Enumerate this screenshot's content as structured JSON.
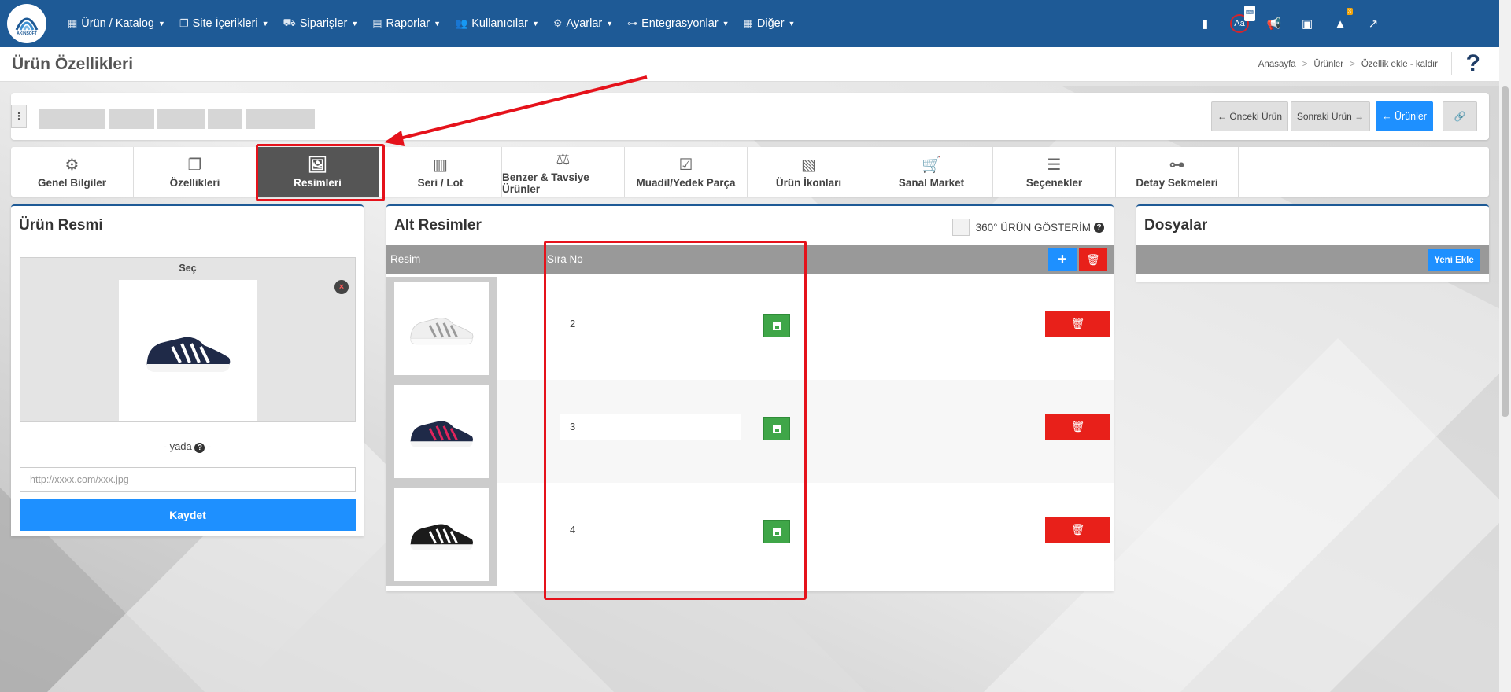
{
  "brand": {
    "logo_text": "AKINSOFT"
  },
  "nav": {
    "items": [
      {
        "label": "Ürün / Katalog",
        "icon": "cubes-icon"
      },
      {
        "label": "Site İçerikleri",
        "icon": "copy-icon"
      },
      {
        "label": "Siparişler",
        "icon": "truck-icon"
      },
      {
        "label": "Raporlar",
        "icon": "file-chart-icon"
      },
      {
        "label": "Kullanıcılar",
        "icon": "users-icon"
      },
      {
        "label": "Ayarlar",
        "icon": "gears-icon"
      },
      {
        "label": "Entegrasyonlar",
        "icon": "sitemap-icon"
      },
      {
        "label": "Diğer",
        "icon": "grid-icon"
      }
    ],
    "right_icons": [
      "book-icon",
      "translate-icon",
      "megaphone-icon",
      "windows-icon",
      "alert-icon",
      "external-edit-icon"
    ],
    "alert_count": "3",
    "keyboard_badge": "⌨"
  },
  "title_bar": {
    "title": "Ürün Özellikleri",
    "breadcrumb": [
      "Anasayfa",
      "Ürünler",
      "Özellik ekle - kaldır"
    ],
    "help": "?"
  },
  "product_header": {
    "prev_label": "Önceki Ürün",
    "next_label": "Sonraki Ürün",
    "products_label": "Ürünler"
  },
  "tabs": [
    {
      "label": "Genel Bilgiler",
      "icon": "gears-icon"
    },
    {
      "label": "Özellikleri",
      "icon": "copy-icon"
    },
    {
      "label": "Resimleri",
      "icon": "images-icon",
      "active": true
    },
    {
      "label": "Seri / Lot",
      "icon": "barcode-icon"
    },
    {
      "label": "Benzer & Tavsiye Ürünler",
      "icon": "balance-icon"
    },
    {
      "label": "Muadil/Yedek Parça",
      "icon": "check-square-icon"
    },
    {
      "label": "Ürün İkonları",
      "icon": "file-image-icon"
    },
    {
      "label": "Sanal Market",
      "icon": "cart-icon"
    },
    {
      "label": "Seçenekler",
      "icon": "list-icon"
    },
    {
      "label": "Detay Sekmeleri",
      "icon": "sitemap-icon"
    }
  ],
  "urun_resmi": {
    "title": "Ürün Resmi",
    "select_label": "Seç",
    "or_label": "-  yada",
    "or_suffix": "-",
    "url_placeholder": "http://xxxx.com/xxx.jpg",
    "save_label": "Kaydet"
  },
  "alt_resimler": {
    "title": "Alt Resimler",
    "checkbox_label": "360° ÜRÜN GÖSTERİM",
    "col_image": "Resim",
    "col_order": "Sıra No",
    "rows": [
      {
        "order": "2",
        "shoe": "white"
      },
      {
        "order": "3",
        "shoe": "navy-pink"
      },
      {
        "order": "4",
        "shoe": "black"
      }
    ]
  },
  "dosyalar": {
    "title": "Dosyalar",
    "add_label": "Yeni Ekle"
  },
  "colors": {
    "nav_bg": "#1e5a96",
    "primary": "#1e90ff",
    "danger": "#e8201a",
    "success": "#3fa648",
    "highlight": "#e5121b"
  }
}
